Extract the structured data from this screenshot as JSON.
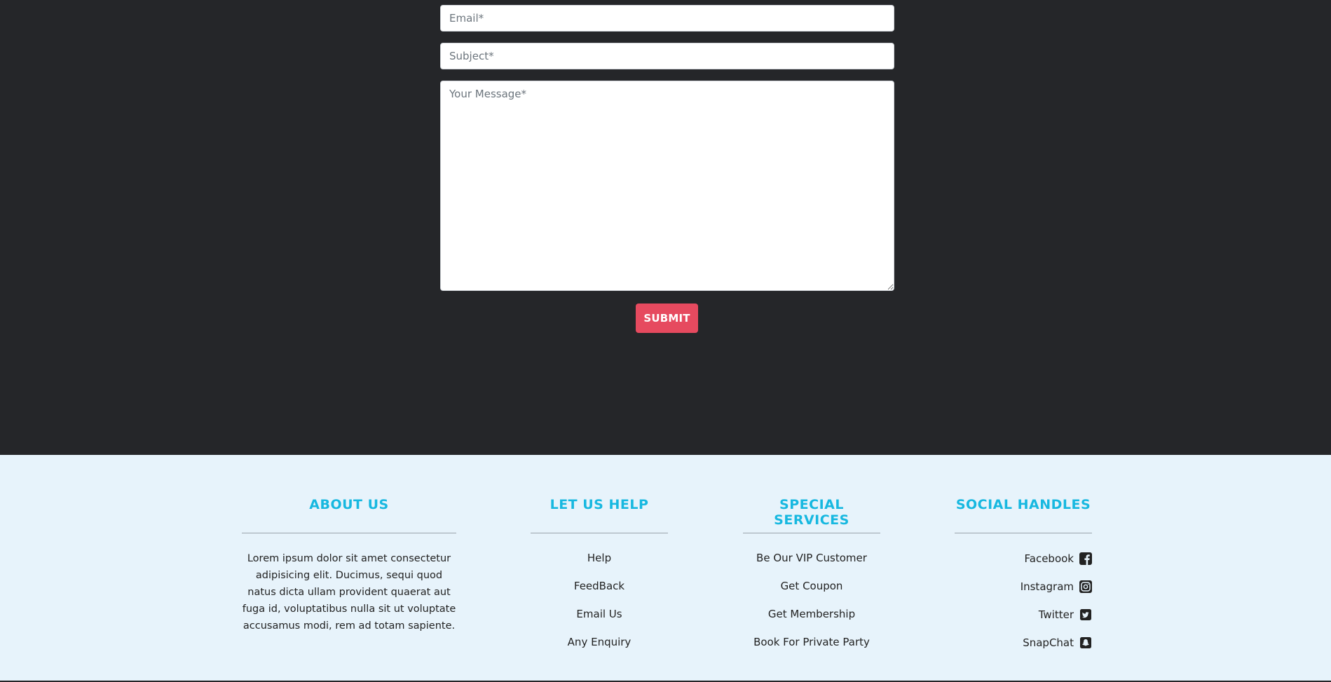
{
  "contact_form": {
    "email_placeholder": "Email*",
    "subject_placeholder": "Subject*",
    "message_placeholder": "Your Message*",
    "submit_label": "SUBMIT"
  },
  "footer": {
    "about": {
      "heading": "ABOUT US",
      "text": "Lorem ipsum dolor sit amet consectetur adipisicing elit. Ducimus, sequi quod natus dicta ullam provident quaerat aut fuga id, voluptatibus nulla sit ut voluptate accusamus modi, rem ad totam sapiente."
    },
    "help": {
      "heading": "LET US HELP",
      "links": [
        "Help",
        "FeedBack",
        "Email Us",
        "Any Enquiry"
      ]
    },
    "special": {
      "heading": "SPECIAL SERVICES",
      "links": [
        "Be Our VIP Customer",
        "Get Coupon",
        "Get Membership",
        "Book For Private Party"
      ]
    },
    "social": {
      "heading": "SOCIAL HANDLES",
      "links": [
        {
          "label": "Facebook",
          "icon": "facebook-square-icon"
        },
        {
          "label": "Instagram",
          "icon": "instagram-icon"
        },
        {
          "label": "Twitter",
          "icon": "twitter-square-icon"
        },
        {
          "label": "SnapChat",
          "icon": "snapchat-square-icon"
        }
      ]
    }
  },
  "colors": {
    "dark_bg": "#252629",
    "footer_bg": "#e7f3fb",
    "accent": "#17b8e0",
    "submit": "#e64a5f"
  }
}
